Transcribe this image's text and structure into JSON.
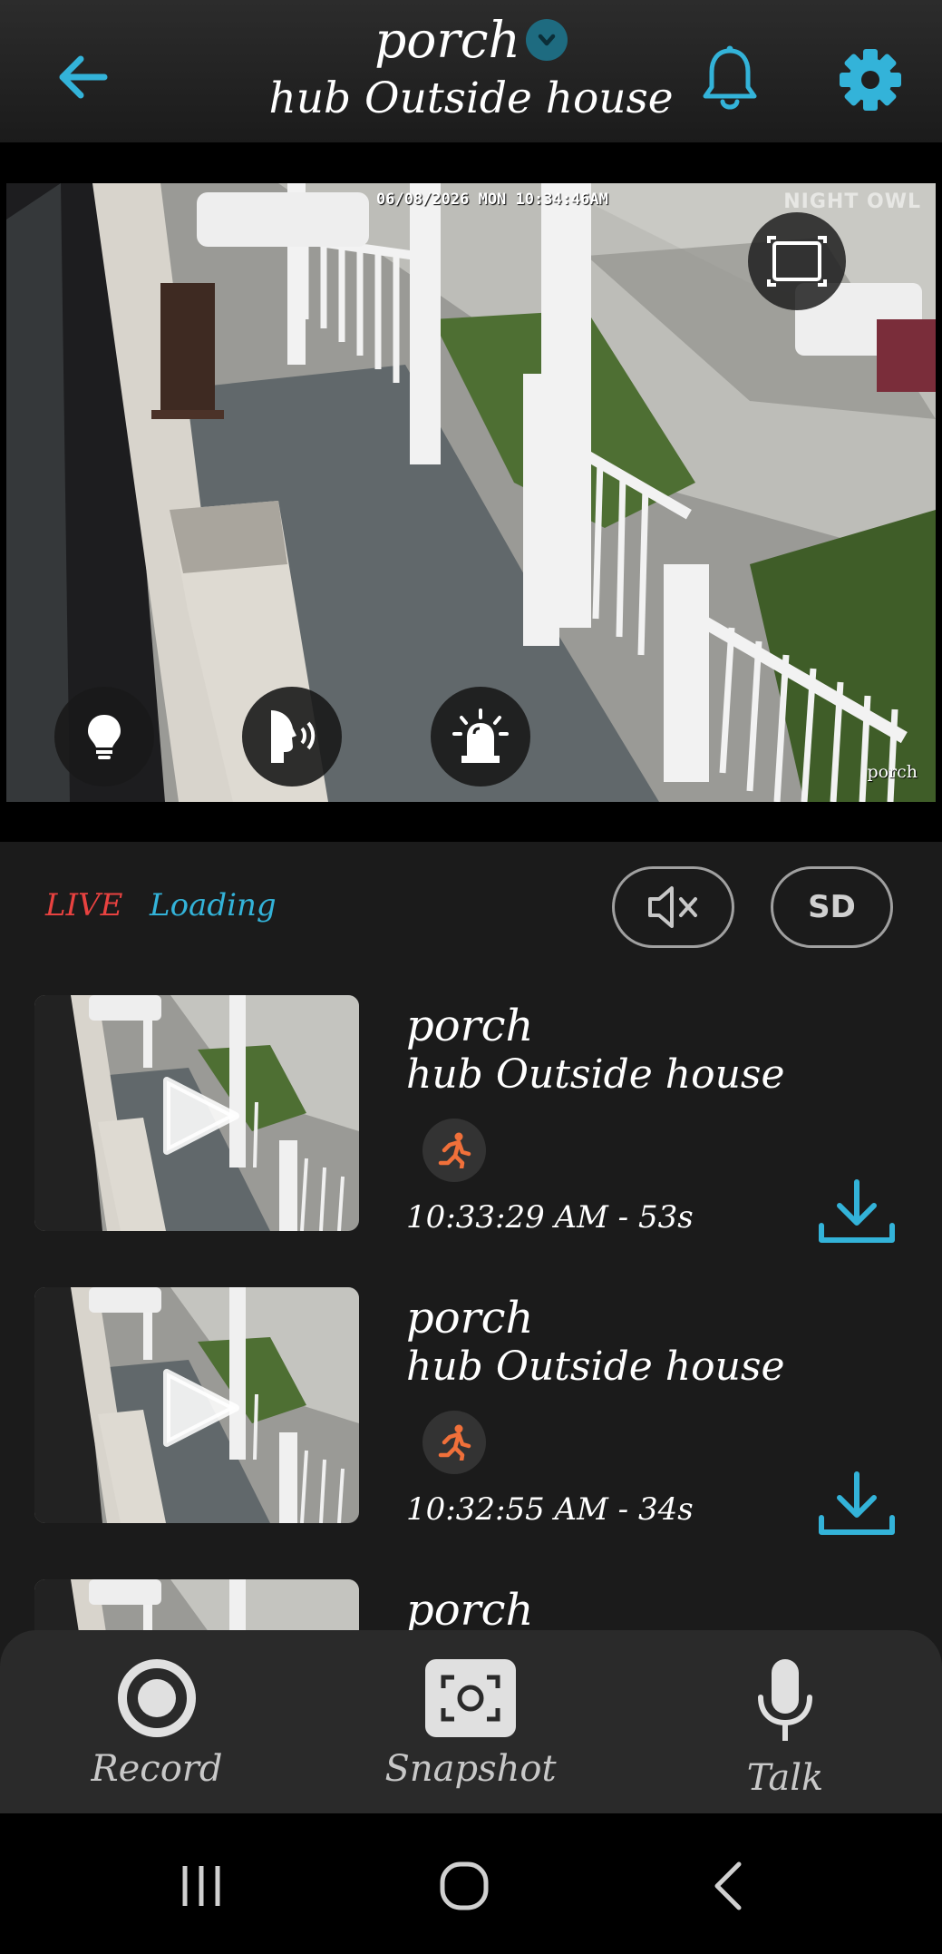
{
  "header": {
    "camera_name": "porch",
    "hub_name": "hub Outside house",
    "icons": {
      "back": "arrow-left-icon",
      "dropdown": "chevron-down-icon",
      "notifications": "bell-icon",
      "settings": "gear-icon"
    }
  },
  "video": {
    "timestamp": "06/08/2026 MON 10:34:46AM",
    "brand_watermark": "NIGHT OWL",
    "camera_label": "porch",
    "controls": [
      "light-bulb-icon",
      "speaker-voice-icon",
      "siren-icon",
      "fullscreen-icon"
    ]
  },
  "status": {
    "live": "LIVE",
    "loading": "Loading",
    "mute_icon": "speaker-muted-icon",
    "quality": "SD"
  },
  "recordings": [
    {
      "camera": "porch",
      "hub": "hub Outside house",
      "time": "10:33:29 AM - 53s",
      "event_icon": "motion-person-icon"
    },
    {
      "camera": "porch",
      "hub": "hub Outside house",
      "time": "10:32:55 AM - 34s",
      "event_icon": "motion-person-icon"
    },
    {
      "camera": "porch"
    }
  ],
  "bottom_bar": {
    "record": "Record",
    "snapshot": "Snapshot",
    "talk": "Talk"
  },
  "colors": {
    "accent": "#33b3d9",
    "live": "#e84240",
    "motion": "#f0703a",
    "background": "#1b1b1b"
  }
}
